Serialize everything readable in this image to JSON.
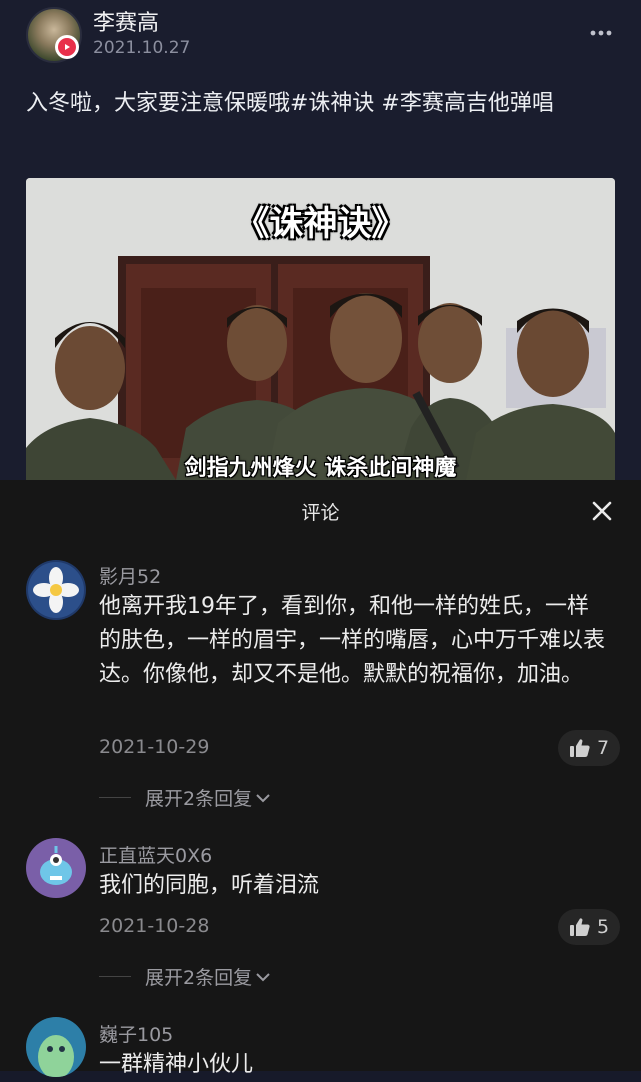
{
  "post": {
    "author": "李赛高",
    "date": "2021.10.27",
    "text": "入冬啦，大家要注意保暖哦#诛神诀 #李赛高吉他弹唱",
    "video": {
      "title": "《诛神诀》",
      "subtitle": "剑指九州烽火 诛杀此间神魔"
    }
  },
  "comments_panel": {
    "title": "评论",
    "comments": [
      {
        "user": "影月52",
        "text": "他离开我19年了，看到你，和他一样的姓氏，一样的肤色，一样的眉宇，一样的嘴唇，心中万千难以表达。你像他，却又不是他。默默的祝福你，加油。",
        "date": "2021-10-29",
        "likes": "7",
        "replies": "展开2条回复"
      },
      {
        "user": "正直蓝天0X6",
        "text": "我们的同胞，听着泪流",
        "date": "2021-10-28",
        "likes": "5",
        "replies": "展开2条回复"
      },
      {
        "user": "巍子105",
        "text": "一群精神小伙儿"
      }
    ]
  },
  "icons": {
    "more": "more-dots-icon",
    "close": "close-icon",
    "like": "thumbs-up-icon",
    "expand": "chevron-down-icon",
    "badge": "play-badge-icon"
  },
  "colors": {
    "post_bg": "#1a1d2e",
    "panel_bg": "#161616",
    "badge_red": "#e8304a"
  }
}
